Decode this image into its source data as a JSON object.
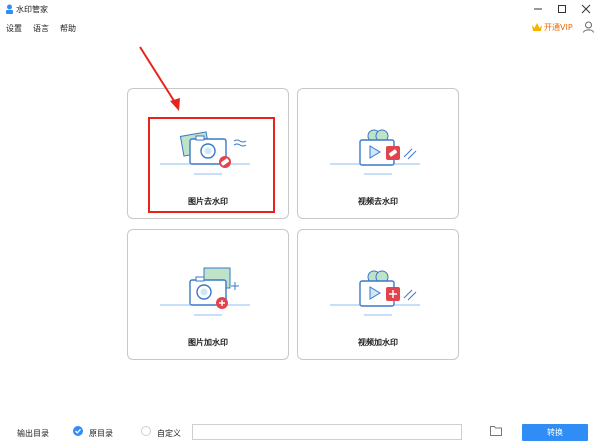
{
  "window": {
    "title": "水印管家"
  },
  "menu": {
    "items": [
      "设置",
      "语言",
      "帮助"
    ],
    "vip_label": "开通VIP"
  },
  "cards": [
    {
      "label": "图片去水印",
      "icon": "photo-remove-watermark-icon"
    },
    {
      "label": "视频去水印",
      "icon": "video-remove-watermark-icon"
    },
    {
      "label": "图片加水印",
      "icon": "photo-add-watermark-icon"
    },
    {
      "label": "视频加水印",
      "icon": "video-add-watermark-icon"
    }
  ],
  "bottom": {
    "output_label": "输出目录",
    "option_original": "原目录",
    "option_custom": "自定义",
    "path_value": "",
    "convert_label": "转换"
  },
  "colors": {
    "accent": "#2f8df5",
    "highlight": "#e8231b",
    "vip": "#f06a00"
  }
}
